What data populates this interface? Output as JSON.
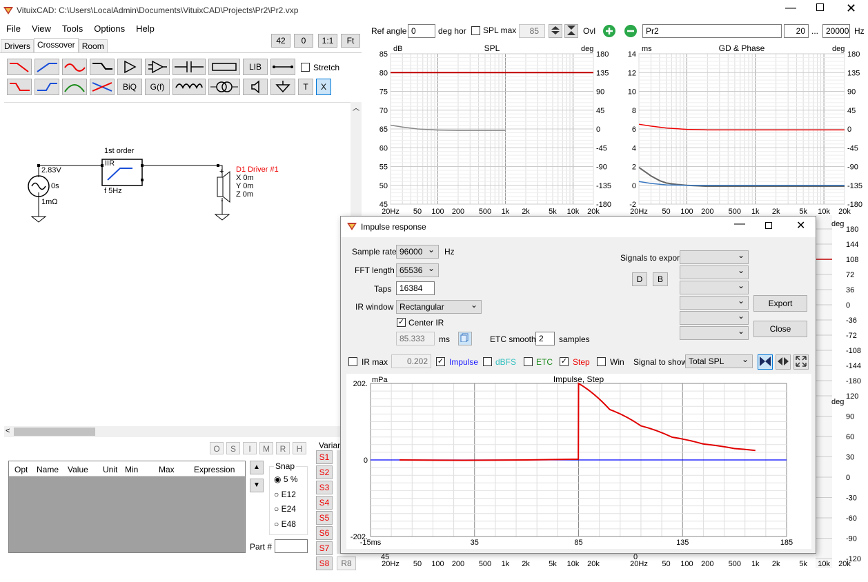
{
  "window": {
    "title": "VituixCAD: C:\\Users\\LocalAdmin\\Documents\\VituixCAD\\Projects\\Pr2\\Pr2.vxp"
  },
  "menu": [
    "File",
    "View",
    "Tools",
    "Options",
    "Help"
  ],
  "zoom": {
    "v1": "42",
    "v2": "0",
    "one": "1:1",
    "fit": "Ft"
  },
  "tabs": [
    "Drivers",
    "Crossover",
    "Room"
  ],
  "toolbar": {
    "lib": "LIB",
    "biq": "BiQ",
    "gf": "G(f)",
    "stretch": "Stretch",
    "t": "T",
    "x": "X"
  },
  "schematic": {
    "block_title": "1st order",
    "block_type": "IIR",
    "block_f": "f  5Hz",
    "src_v": "2.83V",
    "src_t": "0s",
    "src_r": "1mΩ",
    "drv_name": "D1 Driver #1",
    "drv_x": "X 0m",
    "drv_y": "Y 0m",
    "drv_z": "Z 0m"
  },
  "top": {
    "ref_angle_label": "Ref angle",
    "ref_angle": "0",
    "deg_hor": "deg hor",
    "spl_max_label": "SPL max",
    "spl_max": "85",
    "ovl": "Ovl",
    "name": "Pr2",
    "f_low": "20",
    "dots": "...",
    "f_high": "20000",
    "hz": "Hz"
  },
  "spl": {
    "title": "SPL",
    "unit_l": "dB",
    "unit_r": "deg",
    "y": [
      "85",
      "80",
      "75",
      "70",
      "65",
      "60",
      "55",
      "50",
      "45"
    ],
    "yr": [
      "180",
      "135",
      "90",
      "45",
      "0",
      "-45",
      "-90",
      "-135",
      "-180"
    ],
    "x": [
      "20Hz",
      "50",
      "100",
      "200",
      "500",
      "1k",
      "2k",
      "5k",
      "10k",
      "20k"
    ]
  },
  "gd": {
    "title": "GD & Phase",
    "unit_l": "ms",
    "unit_r": "deg",
    "y": [
      "14",
      "12",
      "10",
      "8",
      "6",
      "4",
      "2",
      "0",
      "-2"
    ],
    "yr": [
      "180",
      "135",
      "90",
      "45",
      "0",
      "-45",
      "-90",
      "-135",
      "-180"
    ],
    "x": [
      "20Hz",
      "50",
      "100",
      "200",
      "500",
      "1k",
      "2k",
      "5k",
      "10k",
      "20k"
    ]
  },
  "right_mid": {
    "unit": "deg",
    "y": [
      "180",
      "144",
      "108",
      "72",
      "36",
      "0",
      "-36",
      "-72",
      "-108",
      "-144",
      "-180"
    ]
  },
  "right_bot": {
    "unit": "deg",
    "y": [
      "120",
      "90",
      "60",
      "30",
      "0",
      "-30",
      "-60",
      "-90",
      "-120"
    ]
  },
  "bottom_x": [
    "20Hz",
    "50",
    "100",
    "200",
    "500",
    "1k",
    "2k",
    "5k",
    "10k",
    "20k"
  ],
  "params": {
    "buttons": [
      "O",
      "S",
      "I",
      "M",
      "R",
      "H"
    ],
    "cols": [
      "Opt",
      "Name",
      "Value",
      "Unit",
      "Min",
      "Max",
      "Expression"
    ],
    "snap": "Snap",
    "snap_opts": [
      "5 %",
      "E12",
      "E24",
      "E48"
    ],
    "part": "Part #",
    "variant": "Variant",
    "slots": [
      "S1",
      "S2",
      "S3",
      "S4",
      "S5",
      "S6",
      "S7",
      "S8"
    ],
    "r8": "R8"
  },
  "dialog": {
    "title": "Impulse response",
    "sample_rate_label": "Sample rate",
    "sample_rate": "96000",
    "hz": "Hz",
    "fft_label": "FFT length",
    "fft": "65536",
    "taps_label": "Taps",
    "taps": "16384",
    "irwin_label": "IR window",
    "irwin": "Rectangular",
    "center_ir": "Center IR",
    "delay": "85.333",
    "ms": "ms",
    "etc_label": "ETC smooth",
    "etc": "2",
    "samples": "samples",
    "signals_export": "Signals to export",
    "d": "D",
    "b": "B",
    "export": "Export",
    "close": "Close",
    "irmax": "IR max",
    "irmax_val": "0.202",
    "impulse": "Impulse",
    "dbfs": "dBFS",
    "etcchk": "ETC",
    "step": "Step",
    "win": "Win",
    "signal_show": "Signal to show",
    "signal": "Total SPL"
  },
  "chart_data": {
    "type": "line",
    "title": "Impulse, Step",
    "ylabel": "mPa",
    "yticks": [
      "202.",
      "0",
      "-202."
    ],
    "xticks": [
      "-15ms",
      "35",
      "85",
      "135",
      "185"
    ],
    "xlim": [
      -15,
      185
    ],
    "ylim": [
      -202,
      202
    ],
    "series": [
      {
        "name": "Impulse",
        "color": "#0000ff",
        "x": [
          -15,
          0,
          85,
          85.1,
          185
        ],
        "y": [
          0,
          0,
          0,
          0,
          0
        ]
      },
      {
        "name": "Step",
        "color": "#e00000",
        "x": [
          -1,
          30,
          60,
          84.9,
          85,
          100,
          115,
          130,
          145,
          160,
          170
        ],
        "y": [
          0,
          -1,
          0,
          2,
          202,
          133,
          90,
          60,
          42,
          30,
          25
        ]
      }
    ]
  }
}
